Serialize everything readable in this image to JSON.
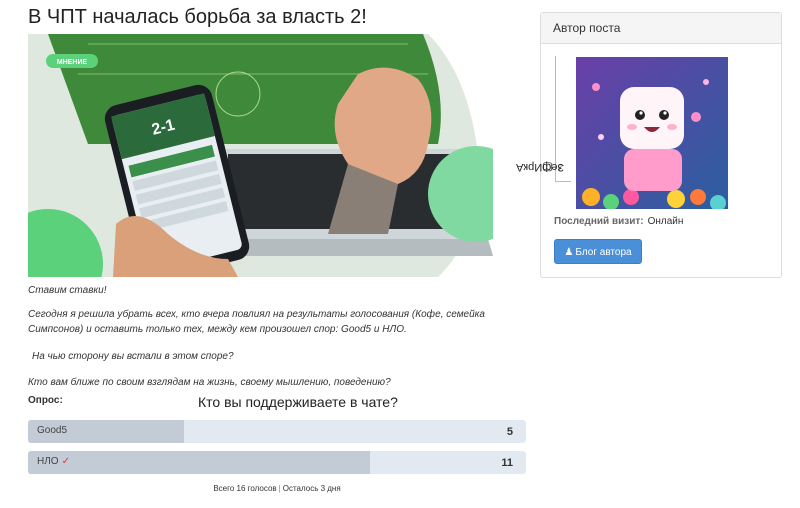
{
  "post": {
    "title": "В ЧПТ началась борьба за власть 2!",
    "badge": "МНЕНИЕ",
    "score_text": "2-1",
    "paragraphs": [
      "Ставим ставки!",
      "Сегодня я решила убрать всех, кто  вчера повлиял на результаты голосования  (Кофе,  семейка Симпсонов) и оставить только тех, между кем произошел спор: Good5 и НЛО.",
      " На чью сторону вы встали в этом споре?",
      "Кто вам ближе по своим взглядам на жизнь, своему мышлению, поведению?"
    ]
  },
  "poll": {
    "label": "Опрос:",
    "question": "Кто вы поддерживаете в чате?",
    "options": [
      {
        "label": "Good5",
        "count": "5",
        "share": 0.3125,
        "voted": false
      },
      {
        "label": "НЛО",
        "count": "11",
        "share": 0.6875,
        "voted": true,
        "check": "✓"
      }
    ],
    "total": "Всего 16 голосов",
    "separator": "|",
    "remaining": "Осталось 3 дня"
  },
  "author": {
    "header": "Автор поста",
    "name": "ЗефИркА",
    "status_icons": "♁ ▢",
    "last_visit_label": "Последний визит:",
    "last_visit_value": "Онлайн",
    "blog_button": "Блог автора",
    "blog_icon": "user-group-icon"
  },
  "colors": {
    "accent": "#4a90d9",
    "badge": "#5ad17a",
    "poll_bg": "#e3e9f1",
    "poll_fill": "#c3cbd6",
    "check": "#e03a3a"
  }
}
